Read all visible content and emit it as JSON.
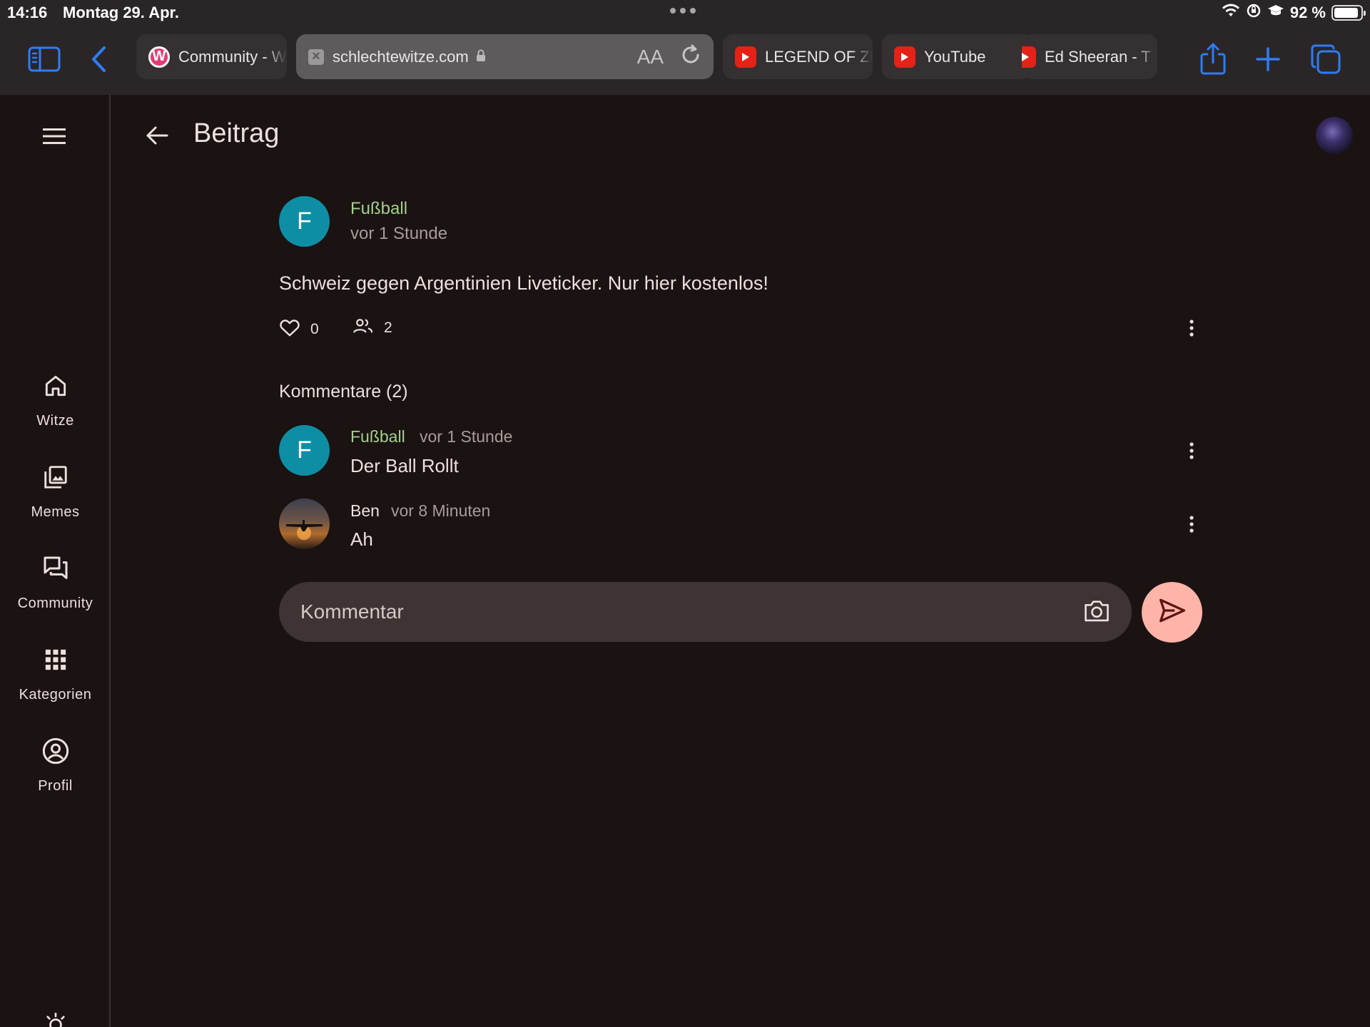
{
  "status_bar": {
    "time": "14:16",
    "date": "Montag 29. Apr.",
    "battery": "92 %",
    "battery_level": 0.92
  },
  "browser": {
    "tabs": [
      {
        "label": "Community - W",
        "icon": "w-logo-favicon",
        "active": false
      },
      {
        "label": "schlechtewitze.com",
        "icon": "close-tab-icon",
        "active": true
      },
      {
        "label": "LEGEND OF ZE",
        "icon": "youtube-favicon",
        "active": false
      },
      {
        "label": "YouTube",
        "icon": "youtube-favicon",
        "active": false
      },
      {
        "label": "Ed Sheeran - T",
        "icon": "youtube-favicon",
        "active": false
      }
    ],
    "reader_label": "AA"
  },
  "nav_rail": {
    "items": [
      {
        "label": "Witze",
        "icon": "home-icon"
      },
      {
        "label": "Memes",
        "icon": "images-icon"
      },
      {
        "label": "Community",
        "icon": "forum-icon"
      },
      {
        "label": "Kategorien",
        "icon": "apps-grid-icon"
      },
      {
        "label": "Profil",
        "icon": "account-circle-icon"
      }
    ]
  },
  "header": {
    "title": "Beitrag"
  },
  "post": {
    "avatar_letter": "F",
    "author": "Fußball",
    "time": "vor 1 Stunde",
    "text": "Schweiz gegen Argentinien Liveticker. Nur hier kostenlos!",
    "likes": "0",
    "participants": "2"
  },
  "comments": {
    "title": "Kommentare (2)",
    "items": [
      {
        "avatar_letter": "F",
        "author": "Fußball",
        "time": "vor 1 Stunde",
        "text": "Der Ball Rollt"
      },
      {
        "avatar_letter": "",
        "author": "Ben",
        "time": "vor 8 Minuten",
        "text": "Ah"
      }
    ]
  },
  "composer": {
    "placeholder": "Kommentar"
  },
  "colors": {
    "background": "#1b1212",
    "accent_author": "#a2d18a",
    "avatar": "#0e8ea5",
    "send_button": "#ffb4a9",
    "safari_blue": "#2f7cf6"
  }
}
